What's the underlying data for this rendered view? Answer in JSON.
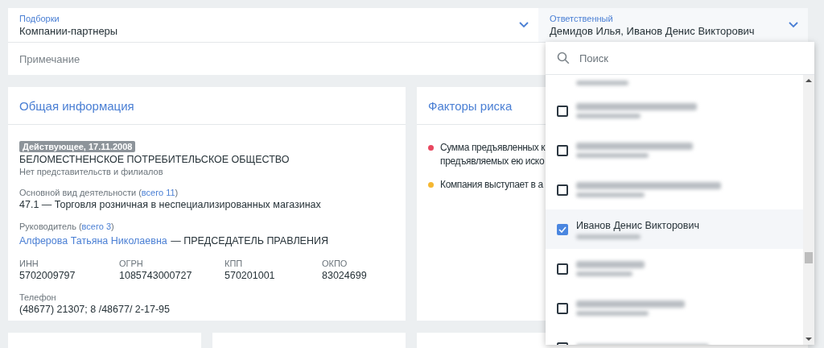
{
  "selection": {
    "label": "Подборки",
    "value": "Компании-партнеры"
  },
  "responsible": {
    "label": "Ответственный",
    "value": "Демидов Илья, Иванов Денис Викторович",
    "expanded": true
  },
  "note": {
    "placeholder": "Примечание"
  },
  "general": {
    "title": "Общая информация",
    "status_badge": "Действующее, 17.11.2008",
    "company_name": "БЕЛОМЕСТНЕНСКОЕ ПОТРЕБИТЕЛЬСКОЕ ОБЩЕСТВО",
    "branches": "Нет представительств и филиалов",
    "activity": {
      "label_before": "Основной вид деятельности (",
      "link": "всего 11",
      "label_after": ")",
      "value": "47.1 — Торговля розничная в неспециализированных магазинах"
    },
    "head": {
      "label_before": "Руководитель (",
      "link": "всего 3",
      "label_after": ")",
      "name": "Алферова Татьяна Николаевна",
      "position": "— ПРЕДСЕДАТЕЛЬ ПРАВЛЕНИЯ"
    },
    "codes": [
      {
        "label": "ИНН",
        "value": "5702009797"
      },
      {
        "label": "ОГРН",
        "value": "1085743000727"
      },
      {
        "label": "КПП",
        "value": "570201001"
      },
      {
        "label": "ОКПО",
        "value": "83024699"
      }
    ],
    "phone": {
      "label": "Телефон",
      "value": "(48677) 21307; 8 /48677/ 2-17-95"
    }
  },
  "risks": {
    "title": "Факторы риска",
    "items": [
      {
        "lines": [
          "Сумма предъявленных к",
          "предъявляемых ею иско"
        ],
        "color": "#e8475f"
      },
      {
        "lines": [
          "Компания выступает в а"
        ],
        "color": "#f5b731"
      }
    ]
  },
  "dropdown": {
    "search": {
      "placeholder": "Поиск"
    },
    "items": [
      {
        "kind": "email_only"
      },
      {
        "kind": "blurred",
        "checked": false
      },
      {
        "kind": "blurred",
        "checked": false
      },
      {
        "kind": "blurred",
        "checked": false
      },
      {
        "kind": "named",
        "name": "Иванов Денис Викторович",
        "checked": true
      },
      {
        "kind": "blurred",
        "checked": false
      },
      {
        "kind": "blurred",
        "checked": false
      },
      {
        "kind": "blurred",
        "checked": false
      }
    ]
  }
}
